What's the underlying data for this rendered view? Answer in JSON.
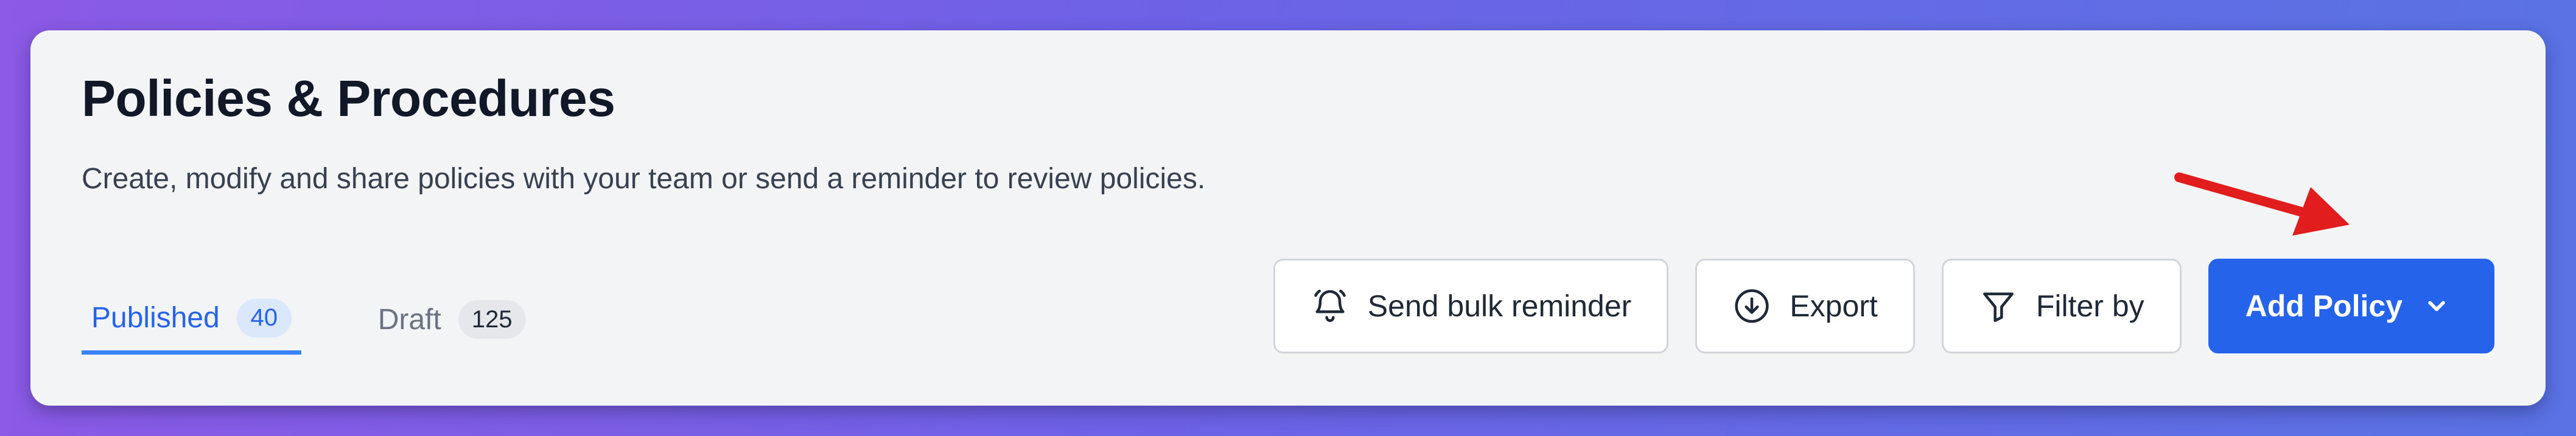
{
  "header": {
    "title": "Policies & Procedures",
    "subtitle": "Create, modify and share policies with your team or send a reminder to review policies."
  },
  "tabs": [
    {
      "label": "Published",
      "count": "40",
      "active": true
    },
    {
      "label": "Draft",
      "count": "125",
      "active": false
    }
  ],
  "actions": {
    "bulk_reminder": {
      "label": "Send bulk reminder",
      "icon": "bell-icon"
    },
    "export": {
      "label": "Export",
      "icon": "download-icon"
    },
    "filter": {
      "label": "Filter by",
      "icon": "filter-icon"
    },
    "add_policy": {
      "label": "Add Policy",
      "icon": "chevron-down-icon"
    }
  },
  "annotation": {
    "icon": "red-arrow-icon",
    "color": "#e11d1d"
  },
  "colors": {
    "accent": "#2563eb",
    "background_gradient": [
      "#8b5ae6",
      "#5a72e4"
    ],
    "card": "#f3f4f6"
  }
}
